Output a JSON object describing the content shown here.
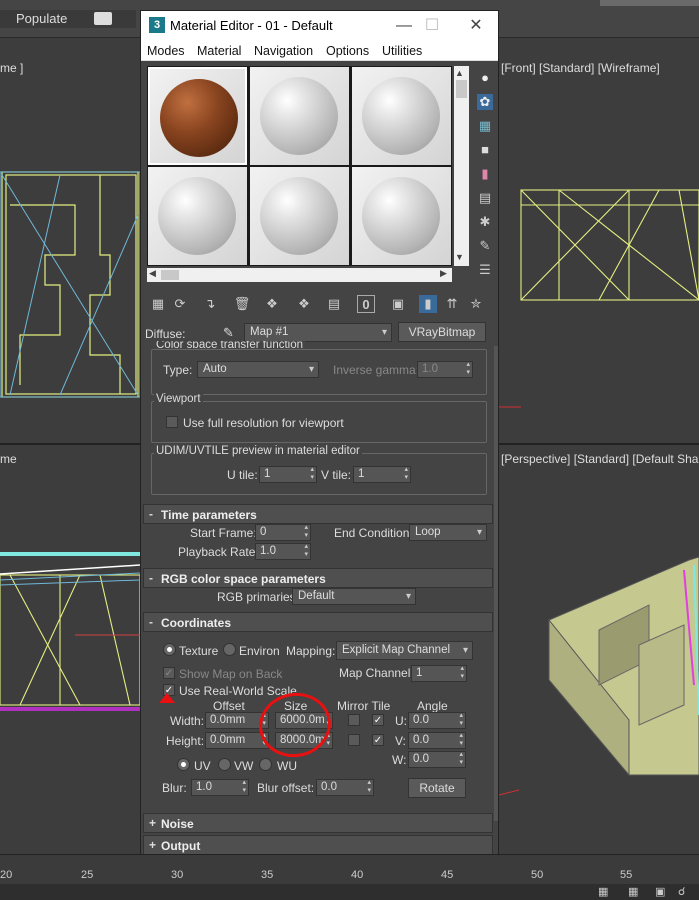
{
  "toolbar": {
    "populate": "Populate"
  },
  "viewports": {
    "front": "[Front] [Standard] [Wireframe]",
    "perspective": "[Perspective] [Standard] [Default Shadi",
    "left_top": "me ]",
    "left_bottom": "me"
  },
  "ruler": {
    "ticks": [
      "20",
      "25",
      "30",
      "35",
      "40",
      "45",
      "50",
      "55"
    ]
  },
  "dialog": {
    "title": "Material Editor - 01 - Default",
    "menu": [
      "Modes",
      "Material",
      "Navigation",
      "Options",
      "Utilities"
    ],
    "diffuse_label": "Diffuse:",
    "map_name": "Map #1",
    "map_type": "VRayBitmap",
    "color_space": {
      "group": "Color space transfer function",
      "type_label": "Type:",
      "type_value": "Auto",
      "gamma_label": "Inverse gamma:",
      "gamma_value": "1.0"
    },
    "viewport": {
      "group": "Viewport",
      "full_res": "Use full resolution for viewport"
    },
    "udim": {
      "group": "UDIM/UVTILE preview in material editor",
      "u_label": "U tile:",
      "u_value": "1",
      "v_label": "V tile:",
      "v_value": "1"
    },
    "time": {
      "title": "Time parameters",
      "start_label": "Start Frame:",
      "start_value": "0",
      "end_label": "End Condition:",
      "end_value": "Loop",
      "rate_label": "Playback Rate:",
      "rate_value": "1.0"
    },
    "rgb": {
      "title": "RGB color space parameters",
      "prim_label": "RGB primaries:",
      "prim_value": "Default"
    },
    "coords": {
      "title": "Coordinates",
      "texture": "Texture",
      "environ": "Environ",
      "mapping_label": "Mapping:",
      "mapping_value": "Explicit Map Channel",
      "show_map": "Show Map on Back",
      "map_channel_label": "Map Channel:",
      "map_channel_value": "1",
      "real_world": "Use Real-World Scale",
      "h_offset": "Offset",
      "h_size": "Size",
      "h_mirror": "Mirror Tile",
      "h_angle": "Angle",
      "width_label": "Width:",
      "width_offset": "0.0mm",
      "width_size": "6000.0m",
      "height_label": "Height:",
      "height_offset": "0.0mm",
      "height_size": "8000.0m",
      "u_label": "U:",
      "u_value": "0.0",
      "v_label": "V:",
      "v_value": "0.0",
      "w_label": "W:",
      "w_value": "0.0",
      "uv": "UV",
      "vw": "VW",
      "wu": "WU",
      "blur_label": "Blur:",
      "blur_value": "1.0",
      "bluroff_label": "Blur offset:",
      "bluroff_value": "0.0",
      "rotate": "Rotate"
    },
    "noise": {
      "title": "Noise"
    },
    "output": {
      "title": "Output"
    }
  }
}
